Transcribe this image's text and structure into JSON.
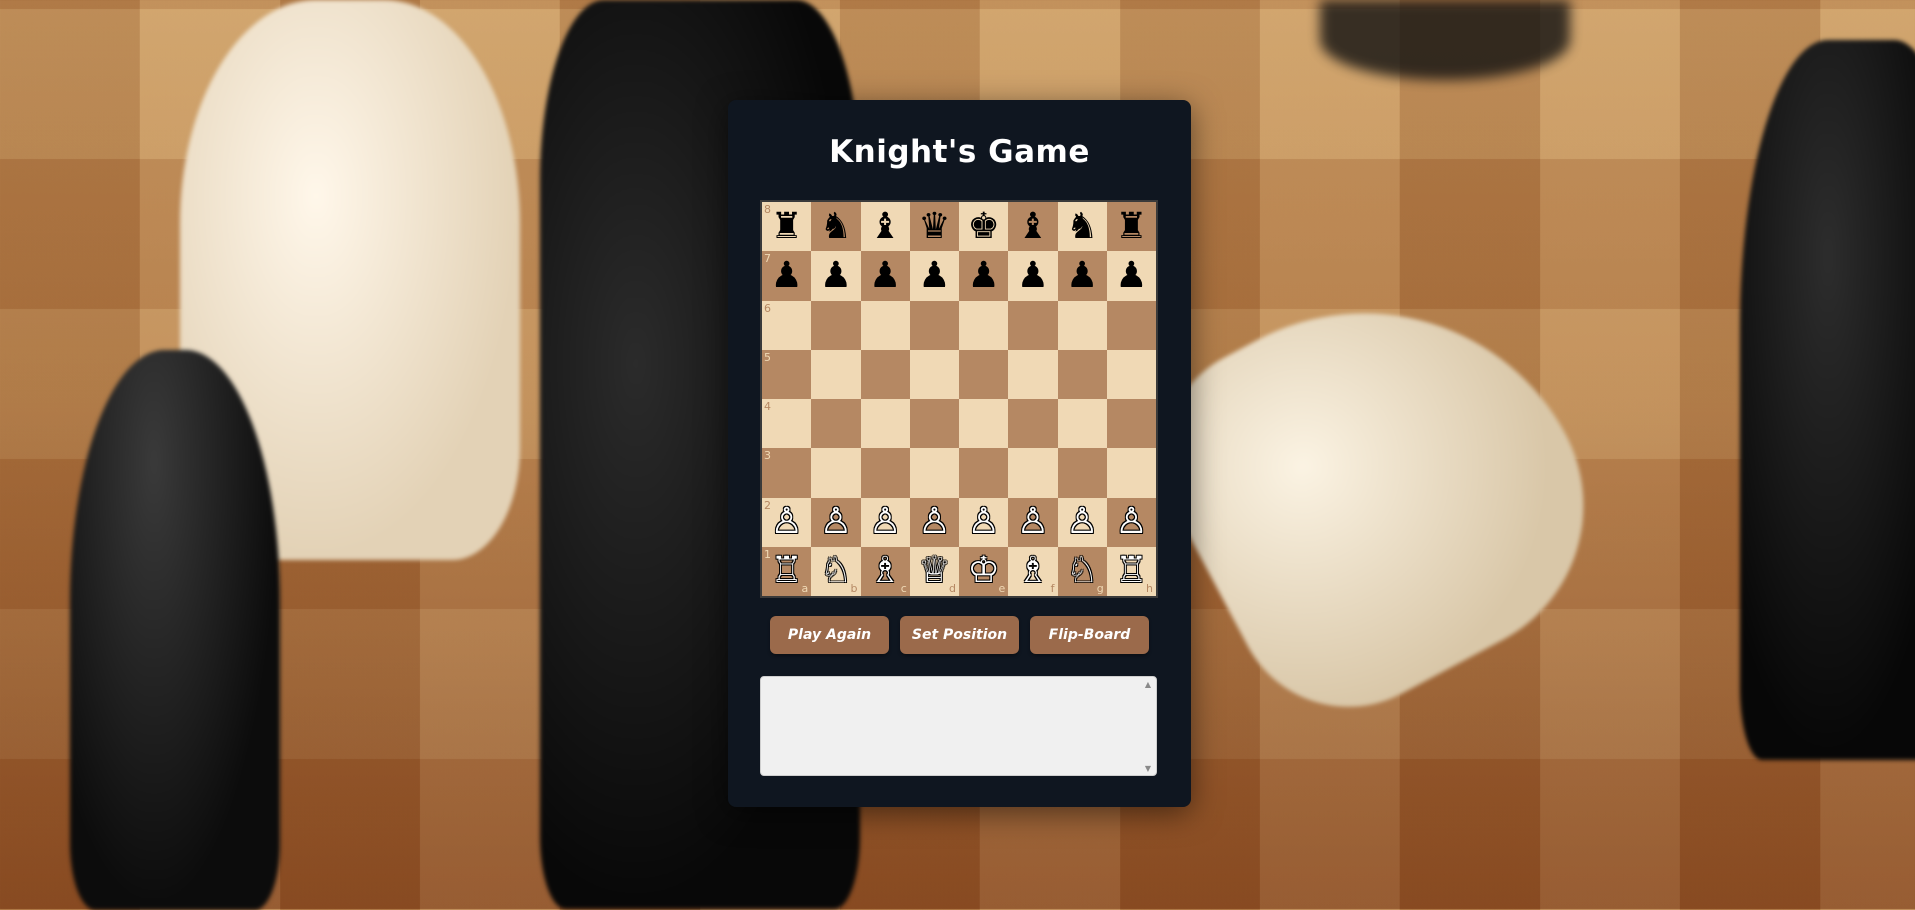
{
  "app": {
    "title": "Knight's Game"
  },
  "board": {
    "ranks": [
      "8",
      "7",
      "6",
      "5",
      "4",
      "3",
      "2",
      "1"
    ],
    "files": [
      "a",
      "b",
      "c",
      "d",
      "e",
      "f",
      "g",
      "h"
    ],
    "position": [
      [
        "♜",
        "♞",
        "♝",
        "♛",
        "♚",
        "♝",
        "♞",
        "♜"
      ],
      [
        "♟",
        "♟",
        "♟",
        "♟",
        "♟",
        "♟",
        "♟",
        "♟"
      ],
      [
        "",
        "",
        "",
        "",
        "",
        "",
        "",
        ""
      ],
      [
        "",
        "",
        "",
        "",
        "",
        "",
        "",
        ""
      ],
      [
        "",
        "",
        "",
        "",
        "",
        "",
        "",
        ""
      ],
      [
        "",
        "",
        "",
        "",
        "",
        "",
        "",
        ""
      ],
      [
        "♙",
        "♙",
        "♙",
        "♙",
        "♙",
        "♙",
        "♙",
        "♙"
      ],
      [
        "♖",
        "♘",
        "♗",
        "♕",
        "♔",
        "♗",
        "♘",
        "♖"
      ]
    ],
    "colors": {
      "light": "#f0d9b5",
      "dark": "#b58863"
    }
  },
  "buttons": {
    "play_again": "Play Again",
    "set_position": "Set Position",
    "flip_board": "Flip-Board"
  },
  "moves": {
    "value": ""
  },
  "colors": {
    "panel": "#0f1620",
    "button": "#9b6a4b"
  }
}
